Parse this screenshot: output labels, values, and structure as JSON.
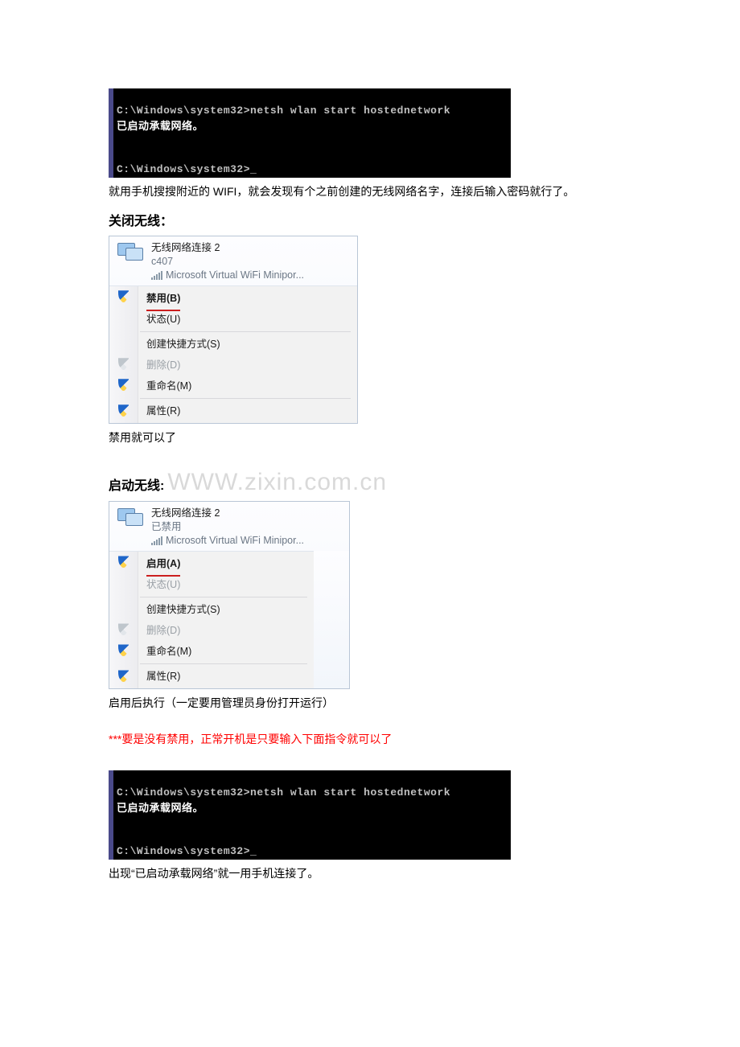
{
  "terminal1": {
    "line1": "C:\\Windows\\system32>netsh wlan start hostednetwork",
    "line2": "已启动承载网络。",
    "line3": "C:\\Windows\\system32>_"
  },
  "captions": {
    "after_term1": "就用手机搜搜附近的 WIFI，就会发现有个之前创建的无线网络名字，连接后输入密码就行了。",
    "section_close": "关闭无线：",
    "after_close_box": "禁用就可以了",
    "section_start": "启动无线:",
    "watermark": "WWW.zixin.com.cn",
    "after_start_box": "启用后执行（一定要用管理员身份打开运行）",
    "red_note": "***要是没有禁用，正常开机是只要输入下面指令就可以了",
    "after_term2": "出现“已启动承载网络”就一用手机连接了。"
  },
  "adapter1": {
    "title": "无线网络连接 2",
    "sub": "c407",
    "desc": "Microsoft Virtual WiFi Minipor...",
    "menu": {
      "disable": "禁用(B)",
      "status": "状态(U)",
      "shortcut": "创建快捷方式(S)",
      "delete": "删除(D)",
      "rename": "重命名(M)",
      "properties": "属性(R)"
    }
  },
  "adapter2": {
    "title": "无线网络连接 2",
    "sub": "已禁用",
    "desc": "Microsoft Virtual WiFi Minipor...",
    "menu": {
      "enable": "启用(A)",
      "status": "状态(U)",
      "shortcut": "创建快捷方式(S)",
      "delete": "删除(D)",
      "rename": "重命名(M)",
      "properties": "属性(R)"
    }
  },
  "terminal2": {
    "line1": "C:\\Windows\\system32>netsh wlan start hostednetwork",
    "line2": "已启动承载网络。",
    "line3": "C:\\Windows\\system32>_"
  }
}
